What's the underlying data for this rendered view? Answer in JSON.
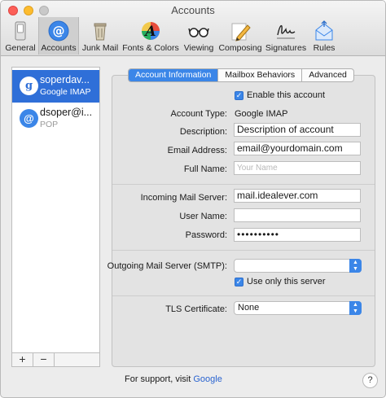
{
  "window": {
    "title": "Accounts"
  },
  "toolbar": {
    "items": [
      {
        "label": "General",
        "icon": "general-switch-icon"
      },
      {
        "label": "Accounts",
        "icon": "at-sign-icon"
      },
      {
        "label": "Junk Mail",
        "icon": "trash-bin-icon"
      },
      {
        "label": "Fonts & Colors",
        "icon": "fonts-colors-icon"
      },
      {
        "label": "Viewing",
        "icon": "glasses-icon"
      },
      {
        "label": "Composing",
        "icon": "pencil-icon"
      },
      {
        "label": "Signatures",
        "icon": "signature-icon"
      },
      {
        "label": "Rules",
        "icon": "rules-envelope-icon"
      }
    ],
    "selected": "Accounts"
  },
  "sidebar": {
    "accounts": [
      {
        "name": "soperdav...",
        "type": "Google IMAP",
        "icon": "google-g-icon",
        "selected": true
      },
      {
        "name": "dsoper@i...",
        "type": "POP",
        "icon": "at-sign-icon",
        "selected": false
      }
    ],
    "add_label": "+",
    "remove_label": "−"
  },
  "tabs": [
    "Account Information",
    "Mailbox Behaviors",
    "Advanced"
  ],
  "form": {
    "enable_label": "Enable this account",
    "enable_checked": true,
    "account_type_label": "Account Type:",
    "account_type_value": "Google IMAP",
    "description_label": "Description:",
    "description_value": "Description of account",
    "email_label": "Email Address:",
    "email_value": "email@yourdomain.com",
    "fullname_label": "Full Name:",
    "fullname_placeholder": "Your Name",
    "incoming_label": "Incoming Mail Server:",
    "incoming_value": "mail.idealever.com",
    "username_label": "User Name:",
    "username_value": "",
    "password_label": "Password:",
    "password_value": "••••••••••",
    "smtp_label": "Outgoing Mail Server (SMTP):",
    "smtp_value": "",
    "only_server_label": "Use only this server",
    "only_server_checked": true,
    "tls_label": "TLS Certificate:",
    "tls_value": "None"
  },
  "footer": {
    "support_text": "For support, visit",
    "support_link": "Google",
    "help_label": "?"
  },
  "colors": {
    "accent": "#3b86e8",
    "selection": "#2f6fd8"
  }
}
